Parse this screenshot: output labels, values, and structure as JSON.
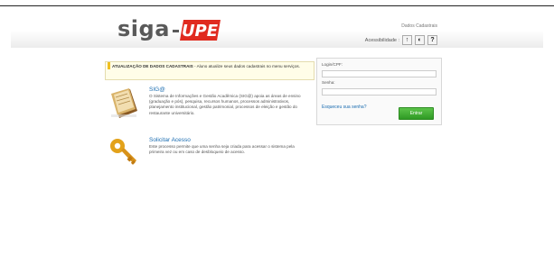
{
  "header": {
    "logo_text": "siga",
    "logo_brand": "UPE",
    "dados_cadastrais": "Dados Cadastrais",
    "acessibilidade_label": "Acessibilidade :",
    "acess_buttons": [
      "↑",
      "◐",
      "?"
    ]
  },
  "notice": {
    "title": "ATUALIZAÇÃO DE DADOS CADASTRAIS",
    "text": " - Aluno atualize seus dados cadastrais no menu serviços."
  },
  "items": [
    {
      "title": "SIG@",
      "desc": "O Sistema de Informações e Gestão Acadêmica (SIG@) apoia as áreas de ensino (graduação e pós), pesquisa, recursos humanos, processos administrativos, planejamento institucional, gestão patrimonial, processos de eleição e gestão do restaurante universitário.",
      "icon": "book-icon"
    },
    {
      "title": "Solicitar Acesso",
      "desc": "Este processo permite que uma senha seja criada para acessar o sistema pela primeira vez ou em caso de desbloqueio de acesso.",
      "icon": "key-icon"
    }
  ],
  "login": {
    "cpf_label": "Login/CPF:",
    "cpf_value": "",
    "senha_label": "Senha:",
    "senha_value": "",
    "forgot": "Esqueceu sua senha?",
    "enter": "Entrar"
  },
  "colors": {
    "link": "#1a6cb0",
    "brand_red": "#e02a1f",
    "button_green": "#3aa62b"
  }
}
